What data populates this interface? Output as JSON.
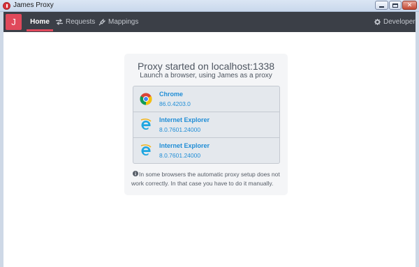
{
  "window": {
    "title": "James Proxy"
  },
  "nav": {
    "logo": "J",
    "items": [
      {
        "label": "Home",
        "icon": "home",
        "active": true
      },
      {
        "label": "Requests",
        "icon": "swap-arrows-icon"
      },
      {
        "label": "Mappings",
        "icon": "plug-icon"
      }
    ],
    "developer_label": "Developer",
    "developer_icon": "gear-icon"
  },
  "colors": {
    "accent": "#e0495b",
    "navbar": "#3b3f47",
    "link": "#1f8dd6"
  },
  "main": {
    "title": "Proxy started on localhost:1338",
    "subtitle": "Launch a browser, using James as a proxy",
    "browsers": [
      {
        "name": "Chrome",
        "version": "86.0.4203.0",
        "icon": "chrome-icon"
      },
      {
        "name": "Internet Explorer",
        "version": "8.0.7601.24000",
        "icon": "internet-explorer-icon"
      },
      {
        "name": "Internet Explorer",
        "version": "8.0.7601.24000",
        "icon": "internet-explorer-icon"
      }
    ],
    "note": "In some browsers the automatic proxy setup does not work correctly. In that case you have to do it manually.",
    "note_icon": "info-icon"
  }
}
